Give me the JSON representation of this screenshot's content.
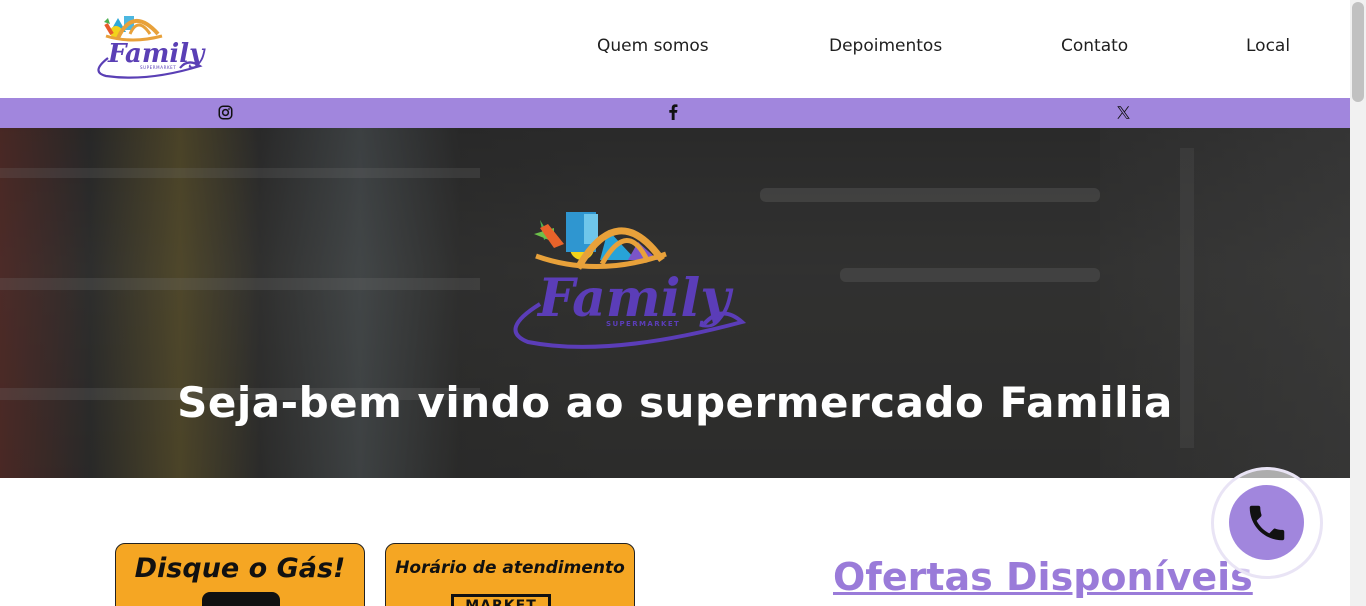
{
  "brand": {
    "logo_text": "Family",
    "logo_subtext": "SUPERMARKET",
    "colors": {
      "purple": "#5a3fb5",
      "lavender": "#a186dd",
      "orange": "#f5a623",
      "gold": "#e8a13a"
    }
  },
  "nav": {
    "items": [
      {
        "label": "Quem somos"
      },
      {
        "label": "Depoimentos"
      },
      {
        "label": "Contato"
      },
      {
        "label": "Local"
      }
    ]
  },
  "social": {
    "icons": [
      "instagram-icon",
      "facebook-icon",
      "x-icon"
    ]
  },
  "hero": {
    "title": "Seja-bem vindo ao supermercado Familia"
  },
  "cards": {
    "gas_title": "Disque o Gás!",
    "hours_title": "Horário de atendimento",
    "market_label": "MARKET"
  },
  "offers": {
    "heading": "Ofertas Disponíveis"
  },
  "fab": {
    "icon": "phone-icon"
  }
}
